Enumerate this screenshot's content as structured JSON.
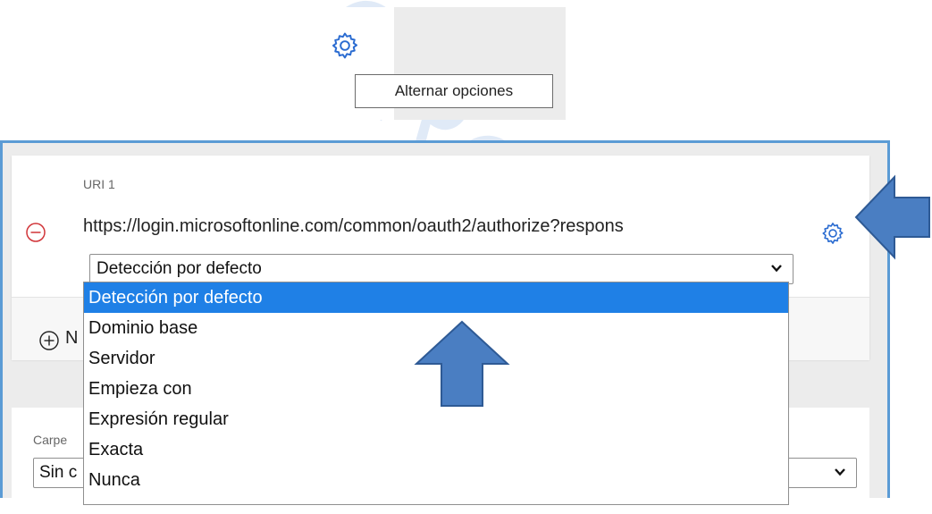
{
  "tooltip": {
    "text": "Alternar opciones"
  },
  "watermark": {
    "text": "ORONRCE"
  },
  "uri": {
    "label": "URI 1",
    "value": "https://login.microsoftonline.com/common/oauth2/authorize?respons",
    "match_selected": "Detección por defecto",
    "add_text": "N"
  },
  "dropdown": {
    "options": [
      "Detección por defecto",
      "Dominio base",
      "Servidor",
      "Empieza con",
      "Expresión regular",
      "Exacta",
      "Nunca"
    ],
    "selected_index": 0
  },
  "folder": {
    "label": "Carpe",
    "value": "Sin c"
  },
  "colors": {
    "accent": "#1f80e6",
    "arrow_fill": "#4a7ec2",
    "arrow_stroke": "#2e5a95",
    "panel_border": "#5b9bd5",
    "remove_red": "#d13438",
    "gear_blue": "#2b6cd1"
  },
  "icons": [
    "gear-icon",
    "remove-circle-icon",
    "add-circle-icon",
    "chevron-down-icon",
    "arrow-left-annotation",
    "arrow-up-annotation"
  ]
}
